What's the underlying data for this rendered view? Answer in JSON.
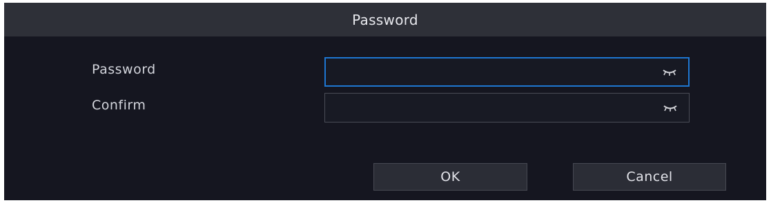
{
  "dialog": {
    "title": "Password",
    "fields": [
      {
        "label": "Password",
        "value": "",
        "placeholder": "",
        "eye_icon": "closed-eye-icon"
      },
      {
        "label": "Confirm",
        "value": "",
        "placeholder": "",
        "eye_icon": "closed-eye-icon"
      }
    ],
    "buttons": {
      "ok_label": "OK",
      "cancel_label": "Cancel"
    }
  },
  "colors": {
    "dialog_background": "#151620",
    "title_bar": "#2e3038",
    "focus_border": "#1e77d2",
    "button_background": "#2b2d36"
  }
}
